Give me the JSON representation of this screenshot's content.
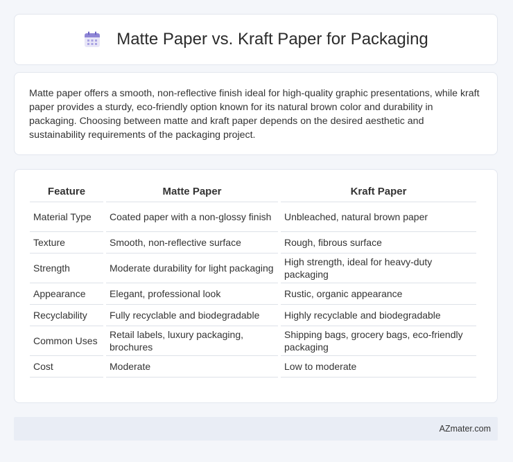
{
  "header": {
    "title": "Matte Paper vs. Kraft Paper for Packaging",
    "icon": "calendar-icon"
  },
  "intro": {
    "text": "Matte paper offers a smooth, non-reflective finish ideal for high-quality graphic presentations, while kraft paper provides a sturdy, eco-friendly option known for its natural brown color and durability in packaging. Choosing between matte and kraft paper depends on the desired aesthetic and sustainability requirements of the packaging project."
  },
  "table": {
    "headers": [
      "Feature",
      "Matte Paper",
      "Kraft Paper"
    ],
    "rows": [
      [
        "Material Type",
        "Coated paper with a non-glossy finish",
        "Unbleached, natural brown paper"
      ],
      [
        "Texture",
        "Smooth, non-reflective surface",
        "Rough, fibrous surface"
      ],
      [
        "Strength",
        "Moderate durability for light packaging",
        "High strength, ideal for heavy-duty packaging"
      ],
      [
        "Appearance",
        "Elegant, professional look",
        "Rustic, organic appearance"
      ],
      [
        "Recyclability",
        "Fully recyclable and biodegradable",
        "Highly recyclable and biodegradable"
      ],
      [
        "Common Uses",
        "Retail labels, luxury packaging, brochures",
        "Shipping bags, grocery bags, eco-friendly packaging"
      ],
      [
        "Cost",
        "Moderate",
        "Low to moderate"
      ]
    ]
  },
  "footer": {
    "text": "AZmater.com"
  }
}
